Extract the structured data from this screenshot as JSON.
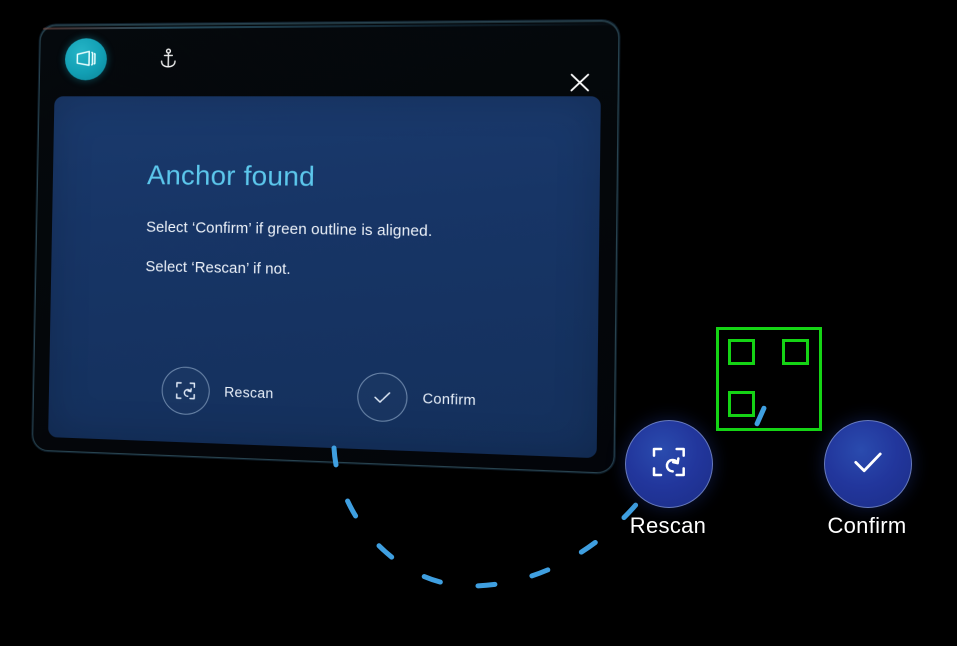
{
  "window": {
    "app_icon": "panel-3d-icon",
    "anchor_icon": "anchor-icon",
    "close_icon": "close-icon",
    "frame_color": "#05090d",
    "accent_teal": "#129fb4"
  },
  "dialog": {
    "title": "Anchor found",
    "title_color": "#5cc7ec",
    "background_color": "#173566",
    "lines": [
      "Select ‘Confirm’ if green outline is aligned.",
      "Select ‘Rescan’ if not."
    ],
    "buttons": [
      {
        "label": "Rescan",
        "icon": "scan-refresh-icon"
      },
      {
        "label": "Confirm",
        "icon": "check-icon"
      }
    ]
  },
  "world_buttons": [
    {
      "label": "Rescan",
      "icon": "scan-refresh-icon",
      "color": "#22369c"
    },
    {
      "label": "Confirm",
      "icon": "check-icon",
      "color": "#22369c"
    }
  ],
  "marker": {
    "name": "anchor-marker-outline",
    "outline_color": "#15d415",
    "corner_squares": 3,
    "highlight_dash_color": "#3f9fe0"
  },
  "connector": {
    "name": "dashed-connector-arc",
    "color": "#3f9fe0",
    "segments": 11
  }
}
